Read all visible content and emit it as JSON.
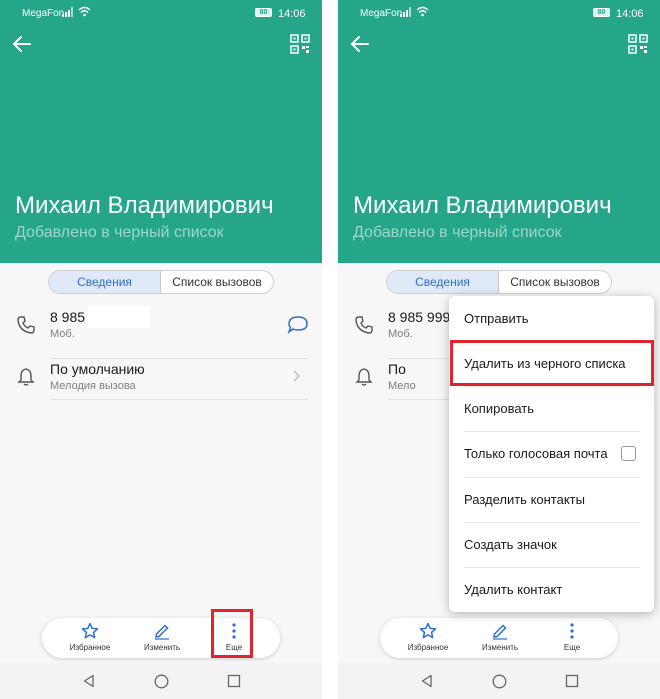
{
  "colors": {
    "header": "#25a688",
    "accent": "#2e6ed0",
    "highlight": "#e02530"
  },
  "status_bar": {
    "carrier": "MegaFon",
    "battery": "80",
    "time": "14:06"
  },
  "contact": {
    "name": "Михаил Владимирович",
    "status": "Добавлено в черный список"
  },
  "tabs": {
    "details": "Сведения",
    "call_log": "Список вызовов"
  },
  "left": {
    "phone": {
      "number": "8 985",
      "type": "Моб."
    },
    "ringtone": {
      "value": "По умолчанию",
      "label": "Мелодия вызова"
    }
  },
  "right": {
    "phone": {
      "number": "8 985 999-",
      "type": "Моб."
    },
    "ringtone": {
      "value": "По",
      "label": "Мело"
    }
  },
  "bottom_bar": {
    "favorites": "Избранное",
    "edit": "Изменить",
    "more": "Еще"
  },
  "menu": {
    "items": [
      {
        "label": "Отправить"
      },
      {
        "label": "Удалить из черного списка"
      },
      {
        "label": "Копировать"
      },
      {
        "label": "Только голосовая почта",
        "checkbox": true,
        "checked": false
      },
      {
        "label": "Разделить контакты"
      },
      {
        "label": "Создать значок"
      },
      {
        "label": "Удалить контакт"
      }
    ]
  },
  "icons": [
    "back-arrow-icon",
    "qr-code-icon",
    "phone-icon",
    "message-icon",
    "bell-icon",
    "chevron-right-icon",
    "star-icon",
    "pencil-icon",
    "more-vertical-icon",
    "nav-back-icon",
    "nav-home-icon",
    "nav-recent-icon",
    "signal-icon",
    "wifi-icon"
  ]
}
